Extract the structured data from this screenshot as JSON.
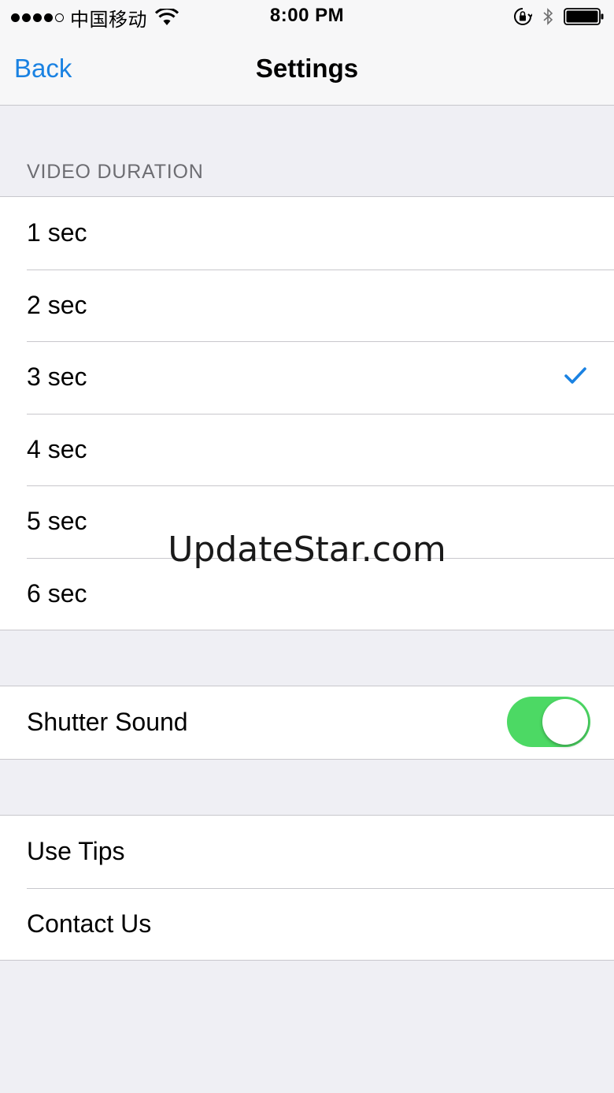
{
  "status_bar": {
    "carrier": "中国移动",
    "time": "8:00 PM",
    "signal_bars_filled": 4,
    "signal_bars_total": 5,
    "icons": [
      "wifi-icon",
      "orientation-lock-icon",
      "bluetooth-icon",
      "battery-icon"
    ]
  },
  "nav": {
    "back_label": "Back",
    "title": "Settings"
  },
  "video_duration": {
    "header": "VIDEO DURATION",
    "options": [
      "1 sec",
      "2 sec",
      "3 sec",
      "4 sec",
      "5 sec",
      "6 sec"
    ],
    "selected": "3 sec"
  },
  "shutter": {
    "label": "Shutter Sound",
    "enabled": true
  },
  "links": {
    "use_tips": "Use Tips",
    "contact_us": "Contact Us"
  },
  "watermark": "UpdateStar.com",
  "colors": {
    "accent": "#1a82e2",
    "toggle_on": "#4cd964",
    "background": "#efeff4"
  }
}
